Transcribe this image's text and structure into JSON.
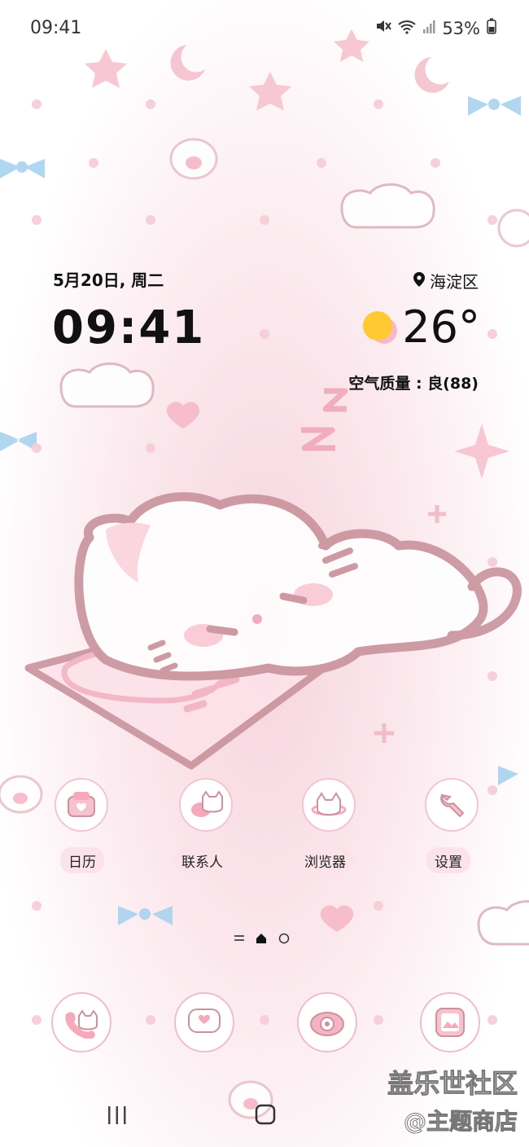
{
  "status_bar": {
    "time": "09:41",
    "battery_percent": "53%",
    "icons": [
      "mute-icon",
      "wifi-icon",
      "signal-icon",
      "battery-icon"
    ]
  },
  "widget": {
    "date": "5月20日, 周二",
    "time": "09:41",
    "location": "海淀区",
    "temperature": "26°",
    "air_quality": "空气质量 : 良(88)",
    "weather_icon": "sunny-icon"
  },
  "apps": [
    {
      "label": "日历",
      "icon": "calendar-icon"
    },
    {
      "label": "联系人",
      "icon": "contacts-icon"
    },
    {
      "label": "浏览器",
      "icon": "browser-icon"
    },
    {
      "label": "设置",
      "icon": "settings-icon"
    }
  ],
  "page_indicator": {
    "pages": 3,
    "current": 2
  },
  "dock": [
    {
      "icon": "phone-icon"
    },
    {
      "icon": "messages-icon"
    },
    {
      "icon": "camera-icon"
    },
    {
      "icon": "gallery-icon"
    }
  ],
  "watermark": {
    "line1": "盖乐世社区",
    "line2": "@主题商店"
  },
  "colors": {
    "accent_pink": "#f2b8c6",
    "outline": "#c9939d",
    "sun": "#ffc933"
  }
}
